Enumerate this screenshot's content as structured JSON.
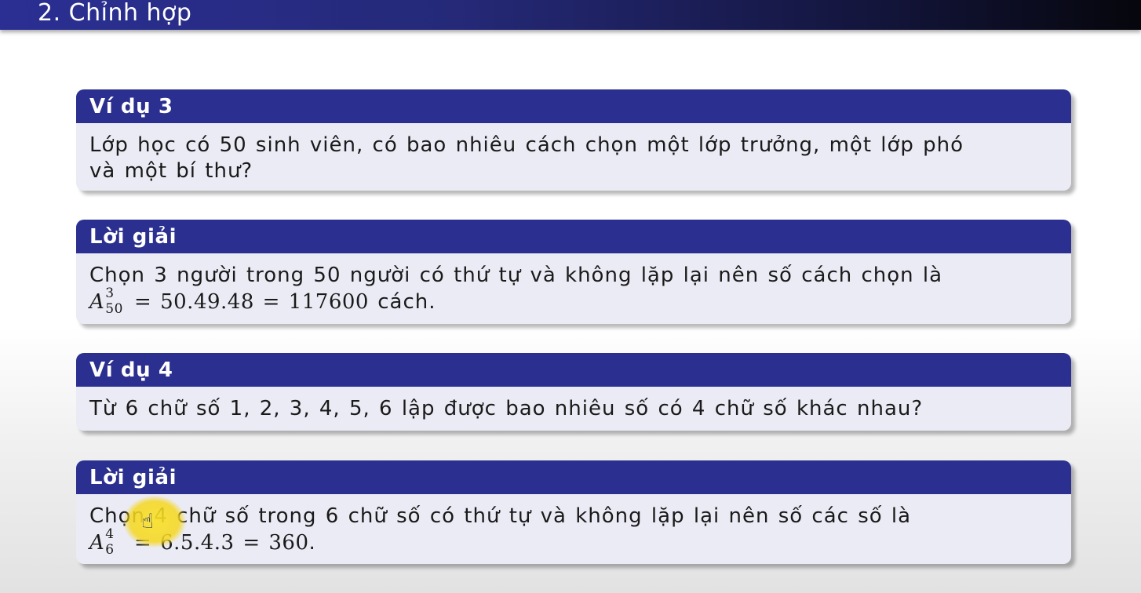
{
  "slide": {
    "title": "2. Chỉnh hợp"
  },
  "blocks": [
    {
      "heading": "Ví dụ 3",
      "lines": [
        "Lớp học có 50 sinh viên, có bao nhiêu cách chọn một lớp trưởng, một lớp phó",
        "và một bí thư?"
      ]
    },
    {
      "heading": "Lời giải",
      "line1": "Chọn 3 người trong 50 người có thứ tự và không lặp lại nên số cách chọn là",
      "math": {
        "symbol": "A",
        "sup": "3",
        "sub": "50",
        "expr": " = 50.49.48 = 117600",
        "suffix": " cách."
      }
    },
    {
      "heading": "Ví dụ 4",
      "lines": [
        "Từ 6 chữ số 1, 2, 3, 4, 5, 6 lập được bao nhiêu số có 4 chữ số khác nhau?"
      ]
    },
    {
      "heading": "Lời giải",
      "line1": "Chọn 4 chữ số trong 6 chữ số có thứ tự và không lặp lại nên số các số là",
      "math": {
        "symbol": "A",
        "sup": "4",
        "sub": "6",
        "expr": " = 6.5.4.3 = 360",
        "suffix": "."
      }
    }
  ],
  "cursor": {
    "icon": "hand-pointer-icon",
    "highlight_color": "#f5d61e"
  }
}
